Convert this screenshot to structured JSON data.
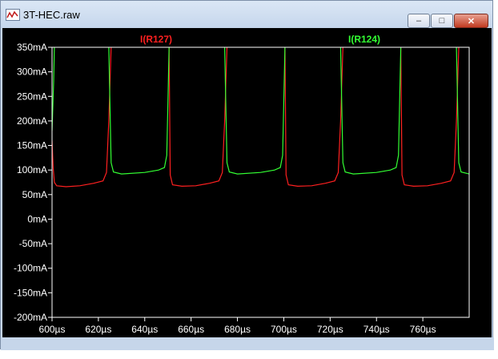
{
  "window": {
    "title": "3T-HEC.raw",
    "icon": "waveform-icon",
    "buttons": {
      "minimize": "–",
      "maximize": "□",
      "close": "✕"
    }
  },
  "colors": {
    "background": "#000000",
    "axis": "#ffffff",
    "series_red": "#ff2020",
    "series_green": "#33ff33"
  },
  "chart_data": {
    "type": "line",
    "xlabel": "",
    "ylabel": "",
    "xlim": [
      600,
      780
    ],
    "ylim": [
      -200,
      350
    ],
    "x_unit": "µs",
    "y_unit": "mA",
    "x_ticks": [
      600,
      620,
      640,
      660,
      680,
      700,
      720,
      740,
      760
    ],
    "x_tick_labels": [
      "600µs",
      "620µs",
      "640µs",
      "660µs",
      "680µs",
      "700µs",
      "720µs",
      "740µs",
      "760µs"
    ],
    "y_ticks": [
      350,
      300,
      250,
      200,
      150,
      100,
      50,
      0,
      -50,
      -100,
      -150,
      -200
    ],
    "y_tick_labels": [
      "350mA",
      "300mA",
      "250mA",
      "200mA",
      "150mA",
      "100mA",
      "50mA",
      "0mA",
      "-50mA",
      "-100mA",
      "-150mA",
      "-200mA"
    ],
    "grid": false,
    "legend_position": "top",
    "series": [
      {
        "name": "I(R127)",
        "color": "#ff2020",
        "x": [
          600,
          600.5,
          601,
          602,
          606,
          612,
          618,
          622,
          623.5,
          624.5,
          625.5,
          625.6,
          650,
          650.5,
          651,
          652,
          656,
          662,
          668,
          672,
          673.5,
          674.5,
          675.5,
          675.6,
          700,
          700.5,
          701,
          702,
          706,
          712,
          718,
          722,
          723.5,
          724.5,
          725.5,
          725.6,
          750,
          750.5,
          751,
          752,
          756,
          762,
          768,
          772,
          773.5,
          774.5,
          775.5,
          775.6
        ],
        "y": [
          160,
          105,
          75,
          68,
          66,
          68,
          73,
          78,
          95,
          200,
          350,
          null,
          null,
          350,
          90,
          70,
          67,
          68,
          73,
          78,
          95,
          200,
          350,
          null,
          null,
          350,
          90,
          70,
          67,
          68,
          73,
          78,
          95,
          200,
          350,
          null,
          null,
          350,
          90,
          70,
          67,
          68,
          73,
          78,
          95,
          200,
          350,
          null
        ]
      },
      {
        "name": "I(R124)",
        "color": "#33ff33",
        "x": [
          600,
          600.7,
          601,
          601.1,
          624,
          624.5,
          625.5,
          626.5,
          630,
          640,
          646,
          648.5,
          649.5,
          650.5,
          650.6,
          674,
          674.5,
          675.5,
          676.5,
          680,
          690,
          696,
          698.5,
          699.5,
          700.5,
          700.6,
          724,
          724.5,
          725.5,
          726.5,
          730,
          740,
          746,
          748.5,
          749.5,
          750.5,
          750.6,
          774,
          774.5,
          775.5,
          776.5,
          780
        ],
        "y": [
          180,
          280,
          350,
          null,
          null,
          350,
          115,
          96,
          92,
          95,
          100,
          105,
          130,
          350,
          null,
          null,
          350,
          115,
          96,
          92,
          95,
          100,
          105,
          130,
          350,
          null,
          null,
          350,
          115,
          96,
          92,
          95,
          100,
          105,
          130,
          350,
          null,
          null,
          350,
          115,
          96,
          92
        ]
      }
    ]
  }
}
